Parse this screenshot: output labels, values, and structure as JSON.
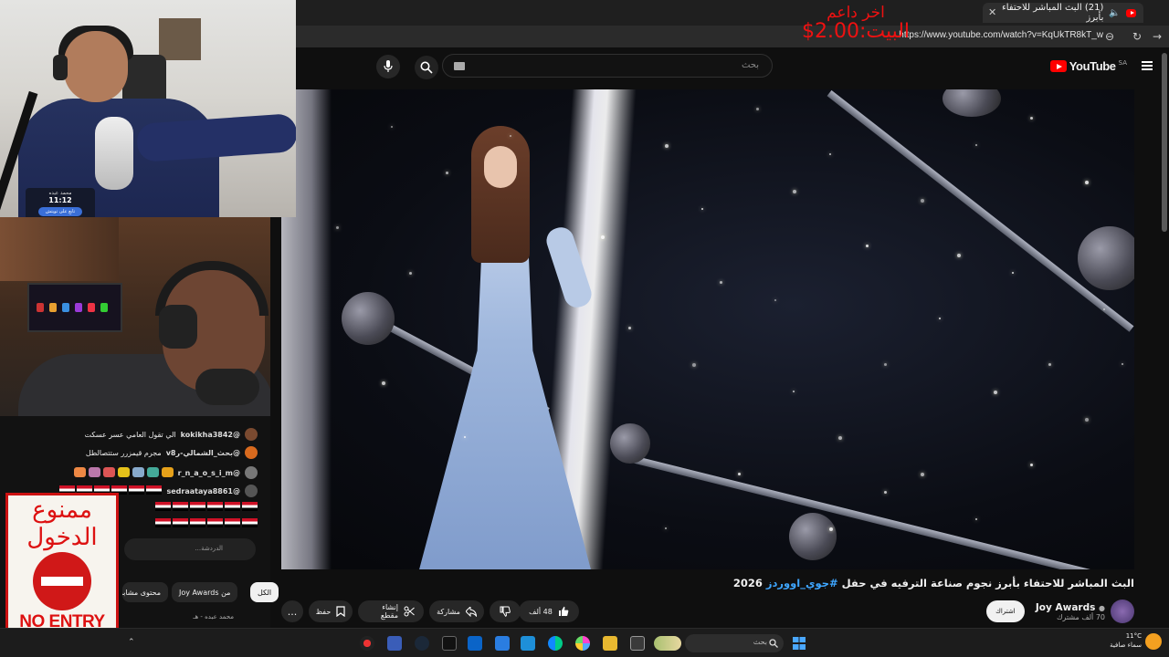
{
  "browser": {
    "tab_title": "(21) البث المباشر للاحتفاء بأبرز",
    "url": "https://www.youtube.com/watch?v=KqUkTR8kT_w"
  },
  "donation_overlay": {
    "line1": "اخر داعم",
    "line2": "البيت:2.00$"
  },
  "youtube": {
    "logo_text": "YouTube",
    "region": "SA",
    "search_placeholder": "بحث"
  },
  "video": {
    "title_prefix": "البث المباشر للاحتفاء بأبرز نجوم صناعة الترفيه في حفل ",
    "title_hashtag": "#جوي_اووردز",
    "title_suffix": " 2026",
    "channel_name": "Joy Awards",
    "channel_subs": "70 ألف مشترك",
    "subscribe_label": "اشتراك",
    "like_count": "48 ألف",
    "share_label": "مشاركة",
    "clip_label": "إنشاء مقطع",
    "save_label": "حفظ",
    "more_label": "..."
  },
  "chips": {
    "all": "الكل",
    "from_channel": "من Joy Awards",
    "similar": "محتوى مشابه"
  },
  "recommended_snippet": "محمد عبده - هـ",
  "streamer_overlay": {
    "name": "محمد عبده",
    "time": "11:12",
    "tag": "تابع على تويتش"
  },
  "chat": {
    "messages": [
      {
        "user": "@kokikha3842",
        "text": "الي تقول العامي عسر عسكت",
        "color": "#7a4a30"
      },
      {
        "user": "@بحث_الشمالي-رv8",
        "text": "مجرم قيمزرر ستتصالطل",
        "color": "#d86a1e"
      },
      {
        "user": "@r_n_a_o_s_i_m",
        "text": "",
        "color": "#777"
      },
      {
        "user": "@sedraataya8861",
        "text": "",
        "color": "#555"
      }
    ],
    "input_placeholder": "الدردشة..."
  },
  "sign": {
    "arabic_line1": "ممنوع",
    "arabic_line2": "الدخول",
    "english": "NO ENTRY"
  },
  "taskbar": {
    "search_placeholder": "بحث",
    "weather_temp": "11°C",
    "weather_desc": "سماء صافية"
  },
  "colors": {
    "youtube_red": "#ff0000",
    "accent_blue": "#3ea6ff",
    "donation_red": "#ee1111"
  }
}
